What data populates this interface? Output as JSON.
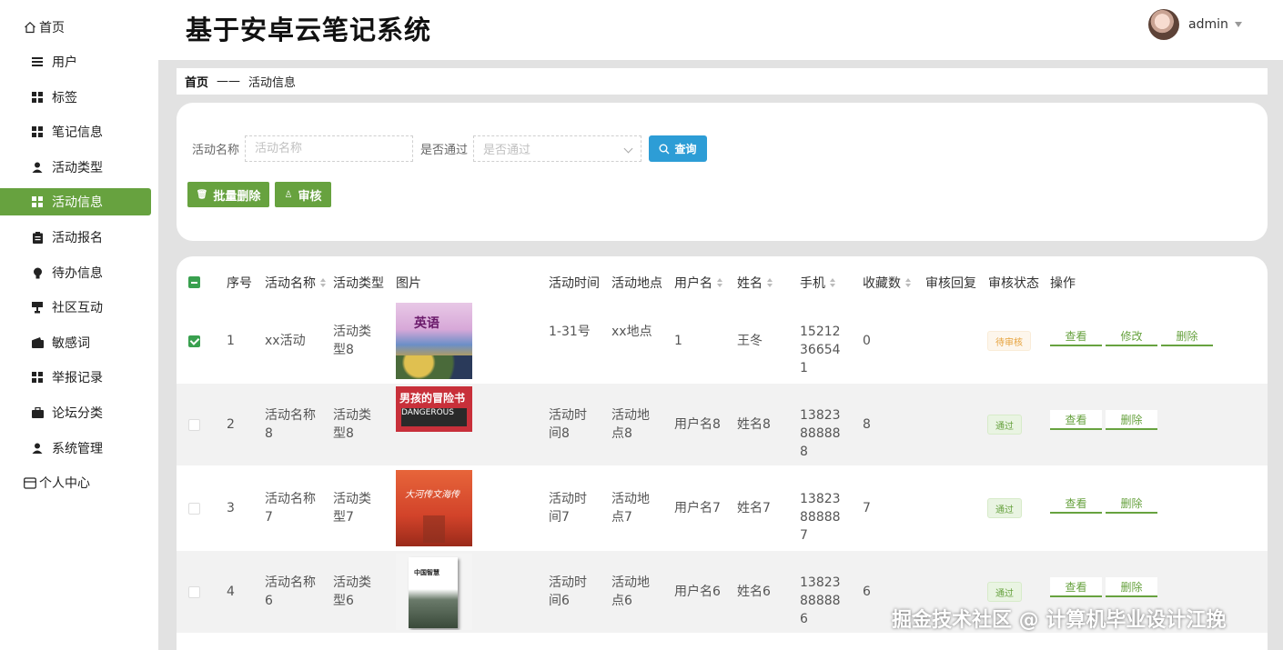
{
  "app": {
    "title": "基于安卓云笔记系统"
  },
  "user": {
    "name": "admin"
  },
  "sidebar": {
    "items": [
      {
        "label": "首页",
        "icon": "home-icon",
        "kind": "top"
      },
      {
        "label": "用户",
        "icon": "list-icon",
        "kind": "sub"
      },
      {
        "label": "标签",
        "icon": "grid-icon",
        "kind": "sub"
      },
      {
        "label": "笔记信息",
        "icon": "grid-icon",
        "kind": "sub"
      },
      {
        "label": "活动类型",
        "icon": "person-icon",
        "kind": "sub"
      },
      {
        "label": "活动信息",
        "icon": "grid-icon",
        "kind": "sub",
        "active": true
      },
      {
        "label": "活动报名",
        "icon": "clipboard-icon",
        "kind": "sub"
      },
      {
        "label": "待办信息",
        "icon": "bulb-icon",
        "kind": "sub"
      },
      {
        "label": "社区互动",
        "icon": "cup-icon",
        "kind": "sub"
      },
      {
        "label": "敏感词",
        "icon": "wallet-icon",
        "kind": "sub"
      },
      {
        "label": "举报记录",
        "icon": "grid-icon",
        "kind": "sub"
      },
      {
        "label": "论坛分类",
        "icon": "briefcase-icon",
        "kind": "sub"
      },
      {
        "label": "系统管理",
        "icon": "person-icon",
        "kind": "sub"
      },
      {
        "label": "个人中心",
        "icon": "card-icon",
        "kind": "top"
      }
    ]
  },
  "breadcrumb": {
    "home": "首页",
    "separator": "——",
    "current": "活动信息"
  },
  "search": {
    "name_label": "活动名称",
    "name_placeholder": "活动名称",
    "pass_label": "是否通过",
    "pass_placeholder": "是否通过",
    "query_button": "查询",
    "batch_delete_button": "批量删除",
    "review_button": "审核"
  },
  "table": {
    "headers": {
      "index": "序号",
      "name": "活动名称",
      "type": "活动类型",
      "image": "图片",
      "time": "活动时间",
      "place": "活动地点",
      "username": "用户名",
      "realname": "姓名",
      "phone": "手机",
      "favorites": "收藏数",
      "reply": "审核回复",
      "status": "审核状态",
      "actions": "操作"
    },
    "rows": [
      {
        "checked": true,
        "index": "1",
        "name": "xx活动",
        "type": "活动类型8",
        "time": "1-31号",
        "place": "xx地点",
        "username": "1",
        "realname": "王冬",
        "phone": "15212366541",
        "favorites": "0",
        "status": "待审核",
        "status_kind": "pending",
        "actions": [
          "查看",
          "修改",
          "删除"
        ],
        "image_text": "英语"
      },
      {
        "checked": false,
        "index": "2",
        "name": "活动名称8",
        "type": "活动类型8",
        "time": "活动时间8",
        "place": "活动地点8",
        "username": "用户名8",
        "realname": "姓名8",
        "phone": "13823888888",
        "favorites": "8",
        "status": "通过",
        "status_kind": "pass",
        "actions": [
          "查看",
          "删除"
        ],
        "image_text": "男孩的冒险书"
      },
      {
        "checked": false,
        "index": "3",
        "name": "活动名称7",
        "type": "活动类型7",
        "time": "活动时间7",
        "place": "活动地点7",
        "username": "用户名7",
        "realname": "姓名7",
        "phone": "13823888887",
        "favorites": "7",
        "status": "通过",
        "status_kind": "pass",
        "actions": [
          "查看",
          "删除"
        ],
        "image_text": "大河传文海传"
      },
      {
        "checked": false,
        "index": "4",
        "name": "活动名称6",
        "type": "活动类型6",
        "time": "活动时间6",
        "place": "活动地点6",
        "username": "用户名6",
        "realname": "姓名6",
        "phone": "13823888886",
        "favorites": "6",
        "status": "通过",
        "status_kind": "pass",
        "actions": [
          "查看",
          "删除"
        ],
        "image_text": "一本书读懂中国智慧"
      }
    ]
  },
  "watermark": "掘金技术社区 @ 计算机毕业设计江挽",
  "colors": {
    "accent": "#67a23f",
    "query": "#2d9dd6",
    "pending": "#e6a23c"
  }
}
